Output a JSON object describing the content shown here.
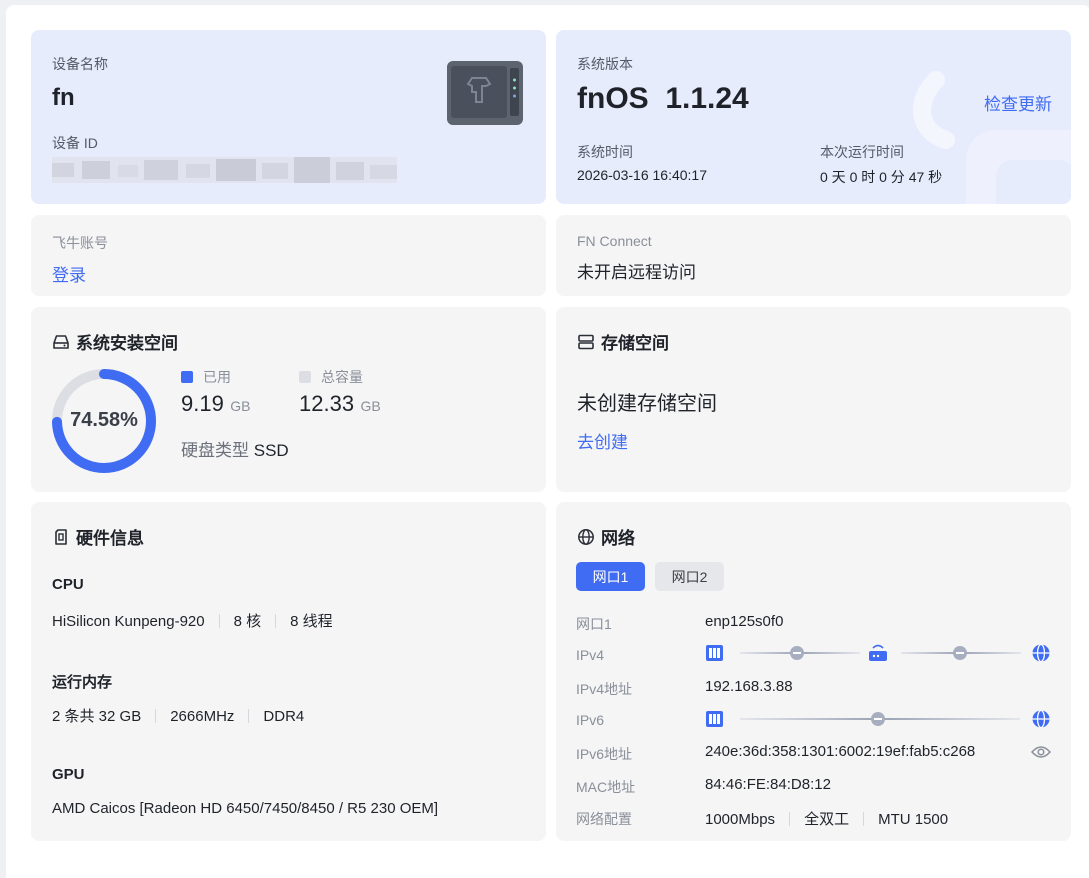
{
  "device": {
    "name_label": "设备名称",
    "name": "fn",
    "id_label": "设备 ID",
    "id_value": ""
  },
  "system": {
    "version_label": "系统版本",
    "version": "fnOS  1.1.24",
    "check_update": "检查更新",
    "time_label": "系统时间",
    "time": "2026-03-16 16:40:17",
    "uptime_label": "本次运行时间",
    "uptime": "0 天 0 时 0 分 47 秒"
  },
  "account": {
    "label": "飞牛账号",
    "login": "登录"
  },
  "connect": {
    "label": "FN Connect",
    "status": "未开启远程访问"
  },
  "install_space": {
    "title": "系统安装空间",
    "percent_text": "74.58%",
    "percent": 74.58,
    "used_label": "已用",
    "used_value": "9.19",
    "used_unit": "GB",
    "total_label": "总容量",
    "total_value": "12.33",
    "total_unit": "GB",
    "disk_type_label": "硬盘类型",
    "disk_type": "SSD",
    "colors": {
      "used": "#3f6cf2",
      "free": "#dcdee3"
    }
  },
  "storage": {
    "title": "存储空间",
    "status": "未创建存储空间",
    "create": "去创建"
  },
  "hardware": {
    "title": "硬件信息",
    "cpu_label": "CPU",
    "cpu_model": "HiSilicon Kunpeng-920",
    "cpu_cores": "8 核",
    "cpu_threads": "8 线程",
    "mem_label": "运行内存",
    "mem_size": "2 条共 32 GB",
    "mem_freq": "2666MHz",
    "mem_type": "DDR4",
    "gpu_label": "GPU",
    "gpu_model": "AMD Caicos [Radeon HD 6450/7450/8450 / R5 230 OEM]"
  },
  "network": {
    "title": "网络",
    "tabs": [
      "网口1",
      "网口2"
    ],
    "port_label": "网口1",
    "port_value": "enp125s0f0",
    "ipv4_label": "IPv4",
    "ipv4_addr_label": "IPv4地址",
    "ipv4_addr": "192.168.3.88",
    "ipv6_label": "IPv6",
    "ipv6_addr_label": "IPv6地址",
    "ipv6_addr": "240e:36d:358:1301:6002:19ef:fab5:c268",
    "mac_label": "MAC地址",
    "mac": "84:46:FE:84:D8:12",
    "config_label": "网络配置",
    "speed": "1000Mbps",
    "duplex": "全双工",
    "mtu": "MTU 1500"
  }
}
